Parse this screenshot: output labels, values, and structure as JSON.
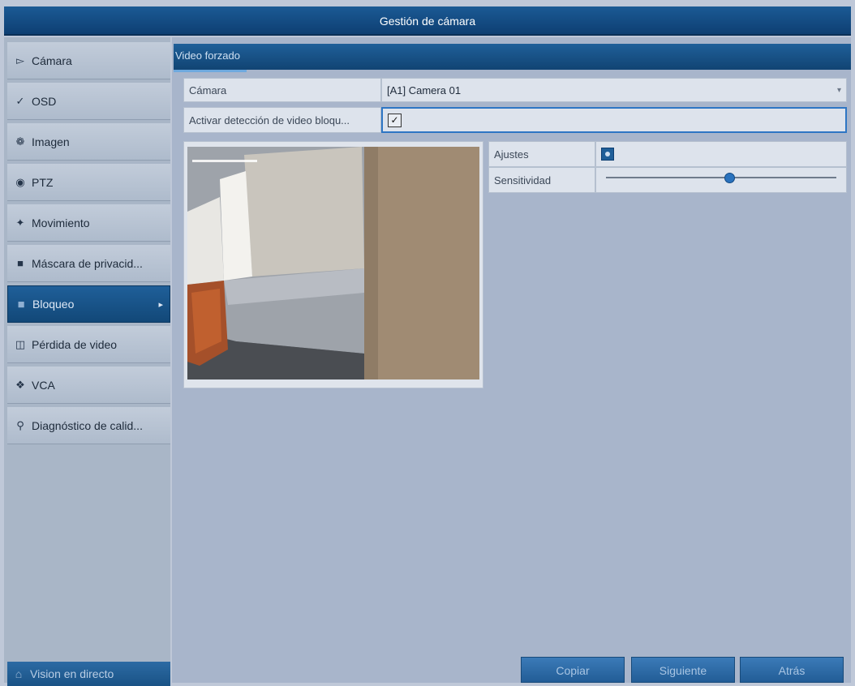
{
  "window": {
    "title": "Gestión de cámara"
  },
  "sidebar": {
    "items": [
      {
        "label": "Cámara",
        "icon": "camera-icon"
      },
      {
        "label": "OSD",
        "icon": "osd-icon"
      },
      {
        "label": "Imagen",
        "icon": "image-icon"
      },
      {
        "label": "PTZ",
        "icon": "ptz-icon"
      },
      {
        "label": "Movimiento",
        "icon": "motion-icon"
      },
      {
        "label": "Máscara de privacid...",
        "icon": "privacy-mask-icon"
      },
      {
        "label": "Bloqueo",
        "icon": "tamper-icon",
        "active": true
      },
      {
        "label": "Pérdida de video",
        "icon": "video-loss-icon"
      },
      {
        "label": "VCA",
        "icon": "vca-icon"
      },
      {
        "label": "Diagnóstico de calid...",
        "icon": "diagnostics-icon"
      }
    ],
    "live_view_label": "Vision en directo"
  },
  "main": {
    "tab": "Video forzado",
    "camera": {
      "label": "Cámara",
      "value": "[A1] Camera 01"
    },
    "enable": {
      "label": "Activar detección de video bloqu...",
      "checked": true
    },
    "settings": {
      "label": "Ajustes"
    },
    "sensitivity": {
      "label": "Sensitividad",
      "level": 0.53
    },
    "buttons": {
      "copy": "Copiar",
      "next": "Siguiente",
      "back": "Atrás"
    }
  },
  "colors": {
    "titlebar": "#124a80",
    "active": "#1f5f99",
    "panel": "#a8b5cb"
  }
}
